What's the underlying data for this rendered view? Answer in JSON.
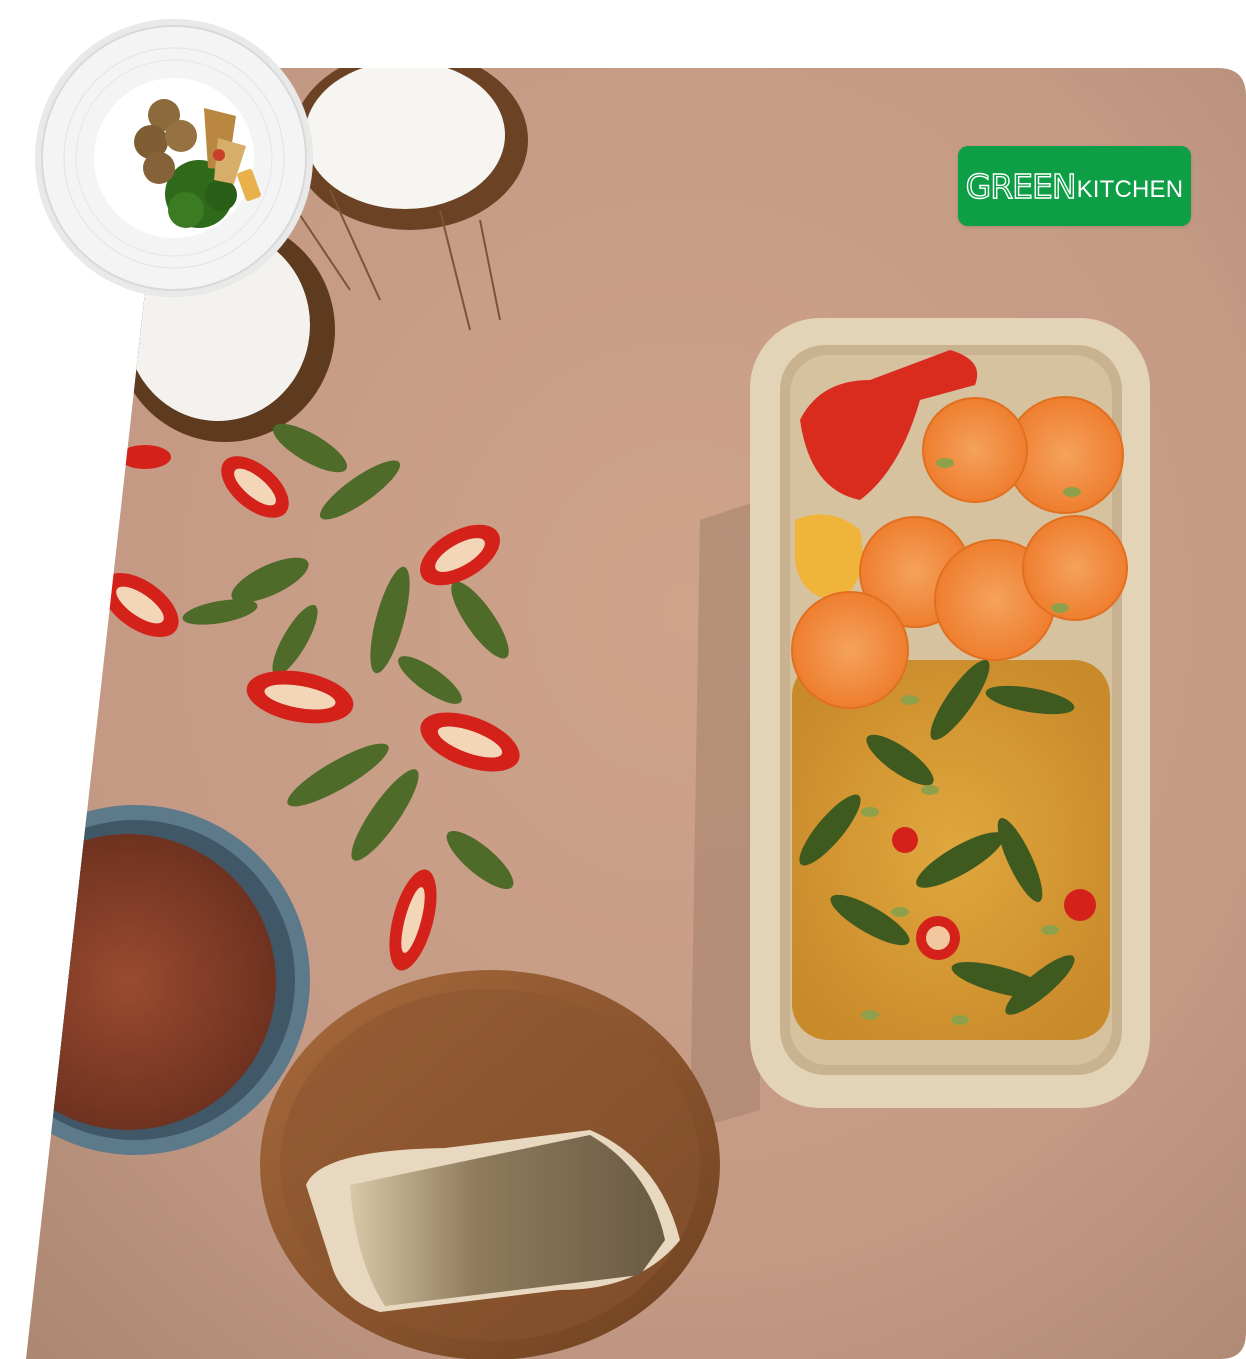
{
  "brand": {
    "logo_part1": "GREEN",
    "logo_part2": "KITCHEN",
    "color": "#0d9e46"
  },
  "photo": {
    "name": "fish-curry-meal-box-flatlay"
  },
  "thumbnail": {
    "name": "meatballs-with-broccoli-plate"
  }
}
